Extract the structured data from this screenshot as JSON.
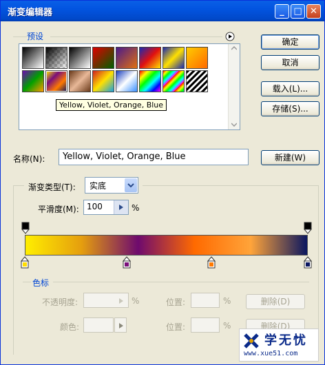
{
  "window": {
    "title": "渐变编辑器",
    "minimize_glyph": "_",
    "maximize_glyph": "□",
    "close_glyph": "✕"
  },
  "presets": {
    "group_label": "预设",
    "menu_icon": "circle-arrow-right-icon",
    "tooltip": "Yellow, Violet, Orange, Blue"
  },
  "buttons": {
    "ok": "确定",
    "cancel": "取消",
    "load": "载入(L)...",
    "save": "存储(S)...",
    "new": "新建(W)"
  },
  "name_field": {
    "label": "名称(N):",
    "value": "Yellow, Violet, Orange, Blue"
  },
  "gradient_type": {
    "label": "渐变类型(T):",
    "value": "实底"
  },
  "smoothness": {
    "label": "平滑度(M):",
    "value": "100",
    "unit": "%"
  },
  "gradient_colors": [
    "#ffee00",
    "#e59e0e",
    "#6e0a6e",
    "#ff6a00",
    "#ffa43a",
    "#0a1660"
  ],
  "color_stops": [
    {
      "position": 0,
      "color": "#ffdd00"
    },
    {
      "position": 36,
      "color": "#7a0f7a"
    },
    {
      "position": 66,
      "color": "#ff7a00"
    },
    {
      "position": 100,
      "color": "#0a1660"
    }
  ],
  "stops_group": {
    "label": "色标",
    "opacity_label": "不透明度:",
    "opacity_unit": "%",
    "color_label": "颜色:",
    "location_label": "位置:",
    "location_unit": "%",
    "delete_label": "删除(D)"
  },
  "watermark": {
    "text": "学无忧",
    "url": "www.xue51.com"
  }
}
